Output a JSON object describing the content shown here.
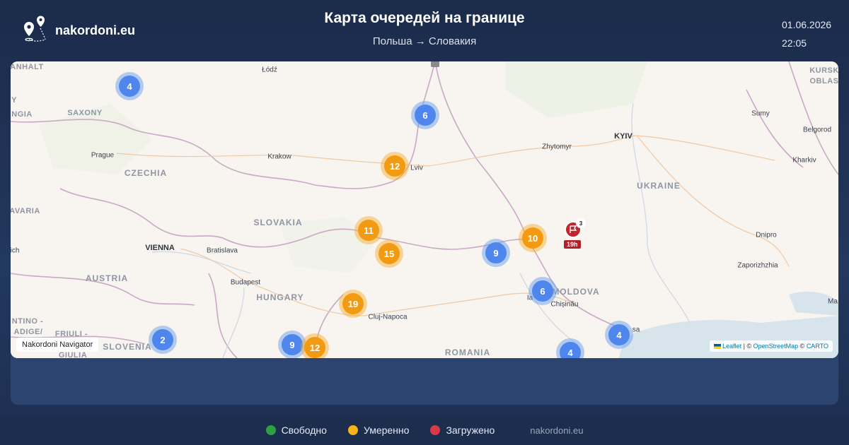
{
  "brand": {
    "name": "nakordoni.eu"
  },
  "header": {
    "title": "Карта очередей на границе",
    "subtitle": "Польша → Словакия",
    "date": "01.06.2026",
    "time": "22:05"
  },
  "map": {
    "labels": {
      "anhalt": "ANHALT",
      "lodz": "Łódź",
      "kursk": "KURSK",
      "oblas": "OBLAS",
      "saxony": "SAXONY",
      "ngia": "NGIA",
      "y": "Y",
      "sumy": "Sumy",
      "belgorod": "Belgorod",
      "kyiv": "KYIV",
      "prague": "Prague",
      "krakow": "Krakow",
      "zhytomyr": "Zhytomyr",
      "kharkiv": "Kharkiv",
      "czechia": "CZECHIA",
      "lviv": "Lviv",
      "ukraine": "UKRAINE",
      "avaria": "AVARIA",
      "slovakia": "SLOVAKIA",
      "dnipro": "Dnipro",
      "ich": "ich",
      "vienna": "VIENNA",
      "bratislava": "Bratislava",
      "zaporizhzhia": "Zaporizhzhia",
      "austria": "AUSTRIA",
      "budapest": "Budapest",
      "moldova": "MOLDOVA",
      "hungary": "HUNGARY",
      "ia": "Ia",
      "chisinau": "Chișinău",
      "ma": "Ma",
      "ntino": "NTINO -",
      "adige": "ADIGE/",
      "cluj": "Cluj-Napoca",
      "friuli": "FRIULI -",
      "giulia": "GIULIA",
      "slovenia": "SLOVENIA",
      "romania": "ROMANIA",
      "sa": "sa"
    },
    "clusters": [
      {
        "count": "4",
        "status": "blue"
      },
      {
        "count": "6",
        "status": "blue"
      },
      {
        "count": "12",
        "status": "orange"
      },
      {
        "count": "11",
        "status": "orange"
      },
      {
        "count": "15",
        "status": "orange"
      },
      {
        "count": "9",
        "status": "blue"
      },
      {
        "count": "10",
        "status": "orange"
      },
      {
        "count": "6",
        "status": "blue"
      },
      {
        "count": "19",
        "status": "orange"
      },
      {
        "count": "4",
        "status": "blue"
      },
      {
        "count": "2",
        "status": "blue"
      },
      {
        "count": "9",
        "status": "blue"
      },
      {
        "count": "12",
        "status": "orange"
      },
      {
        "count": "4",
        "status": "blue"
      }
    ],
    "alert_marker": {
      "count": "3",
      "badge": "19h"
    },
    "navigator_label": "Nakordoni Navigator",
    "attribution": {
      "leaflet": "Leaflet",
      "sep1": " | © ",
      "osm": "OpenStreetMap",
      "sep2": " © ",
      "carto": "CARTO"
    }
  },
  "legend": {
    "items": [
      {
        "label": "Свободно",
        "color": "#2ea043"
      },
      {
        "label": "Умеренно",
        "color": "#f5b418"
      },
      {
        "label": "Загружено",
        "color": "#d73a49"
      }
    ],
    "site": "nakordoni.eu"
  },
  "colors": {
    "cluster_blue": "#4f86ee",
    "cluster_orange": "#f29b12",
    "alert_red": "#c0262d"
  }
}
